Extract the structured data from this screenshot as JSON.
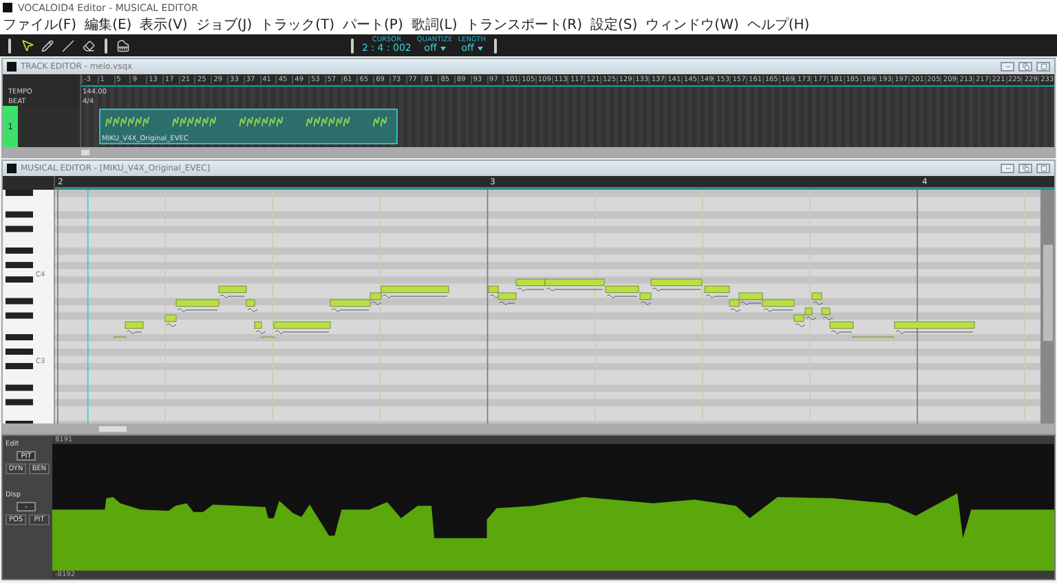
{
  "app_title": "VOCALOID4 Editor - MUSICAL EDITOR",
  "menu": [
    "ファイル(F)",
    "編集(E)",
    "表示(V)",
    "ジョブ(J)",
    "トラック(T)",
    "パート(P)",
    "歌詞(L)",
    "トランスポート(R)",
    "設定(S)",
    "ウィンドウ(W)",
    "ヘルプ(H)"
  ],
  "toolbar": {
    "cursor_label": "CURSOR",
    "cursor_value": "2 : 4 : 002",
    "quantize_label": "QUANTIZE",
    "quantize_value": "off",
    "length_label": "LENGTH",
    "length_value": "off"
  },
  "track_editor": {
    "title": "TRACK EDITOR - melo.vsqx",
    "measures": [
      "-3",
      "1",
      "5",
      "9",
      "13",
      "17",
      "21",
      "25",
      "29",
      "33",
      "37",
      "41",
      "45",
      "49",
      "53",
      "57",
      "61",
      "65",
      "69",
      "73",
      "77",
      "81",
      "85",
      "89",
      "93",
      "97",
      "101",
      "105",
      "109",
      "113",
      "117",
      "121",
      "125",
      "129",
      "133",
      "137",
      "141",
      "145",
      "149",
      "153",
      "157",
      "161",
      "165",
      "169",
      "173",
      "177",
      "181",
      "185",
      "189",
      "193",
      "197",
      "201",
      "205",
      "209",
      "213",
      "217",
      "221",
      "225",
      "229",
      "233"
    ],
    "tempo_label": "TEMPO",
    "tempo_value": "144.00",
    "beat_label": "BEAT",
    "beat_value": "4/4",
    "track_number": "1",
    "part_name": "MIKU_V4X_Original_EVEC"
  },
  "musical_editor": {
    "title": "MUSICAL EDITOR - [MIKU_V4X_Original_EVEC]",
    "bars": [
      "2",
      "3",
      "4"
    ],
    "octave_labels": [
      "C4",
      "C3"
    ]
  },
  "control_track": {
    "max": "8191",
    "min": "-8192",
    "edit_label": "Edit",
    "edit_value": "PIT",
    "edit_options": [
      "DYN",
      "BEN"
    ],
    "disp_label": "Disp",
    "disp_value": "-",
    "disp_options": [
      "POS",
      "PIT"
    ]
  }
}
